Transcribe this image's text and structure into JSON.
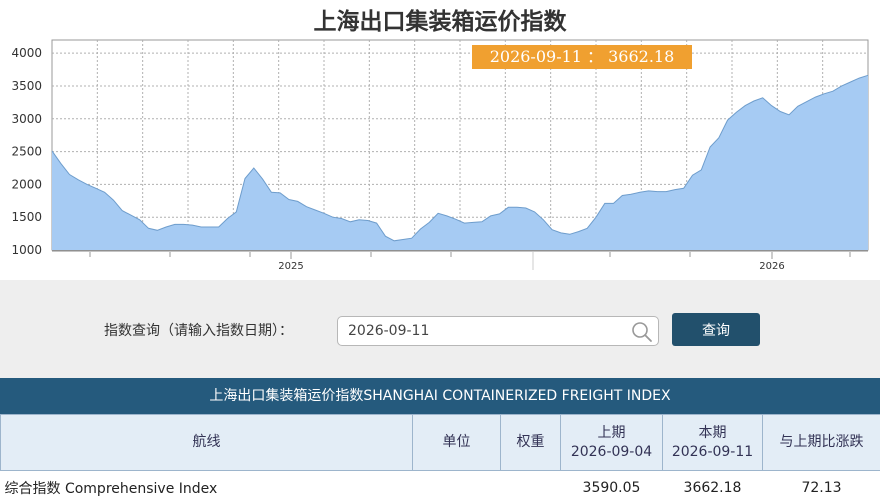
{
  "page": {
    "title": "上海出口集装箱运价指数"
  },
  "tooltip": {
    "text": "2026-09-11 ： 3662.18"
  },
  "colors": {
    "area_fill": "#a6cbf3",
    "area_line": "#6e9dcc",
    "tooltip_bg": "#f0a030",
    "header_bg": "#255a7d",
    "button_bg": "#22506c"
  },
  "chart_data": {
    "type": "area",
    "title": "上海出口集装箱运价指数",
    "xlabel": "",
    "ylabel": "",
    "ylim": [
      1000,
      4200
    ],
    "yticks": [
      1000,
      1500,
      2000,
      2500,
      3000,
      3500,
      4000
    ],
    "x_tick_labels": [
      "2025",
      "2026"
    ],
    "grid": true,
    "series": [
      {
        "values": [
          2510,
          2320,
          2150,
          2070,
          2000,
          1940,
          1880,
          1760,
          1600,
          1530,
          1460,
          1330,
          1300,
          1350,
          1390,
          1390,
          1380,
          1350,
          1350,
          1350,
          1480,
          1580,
          2090,
          2250,
          2080,
          1880,
          1870,
          1770,
          1740,
          1660,
          1610,
          1560,
          1500,
          1480,
          1430,
          1460,
          1450,
          1410,
          1210,
          1140,
          1160,
          1180,
          1320,
          1420,
          1560,
          1520,
          1470,
          1410,
          1420,
          1430,
          1520,
          1550,
          1650,
          1650,
          1640,
          1580,
          1460,
          1310,
          1260,
          1240,
          1280,
          1330,
          1500,
          1710,
          1710,
          1830,
          1850,
          1880,
          1900,
          1890,
          1890,
          1920,
          1940,
          2140,
          2220,
          2570,
          2710,
          2980,
          3100,
          3200,
          3270,
          3320,
          3200,
          3110,
          3060,
          3190,
          3260,
          3330,
          3380,
          3420,
          3500,
          3560,
          3620,
          3662.18
        ]
      }
    ]
  },
  "query": {
    "label": "指数查询（请输入指数日期）：",
    "value": "2026-09-11",
    "button": "查询"
  },
  "table": {
    "title": "上海出口集装箱运价指数SHANGHAI CONTAINERIZED FREIGHT INDEX",
    "headers": {
      "route": "航线",
      "unit": "单位",
      "weight": "权重",
      "prev": "上期",
      "prev_date": "2026-09-04",
      "current": "本期",
      "current_date": "2026-09-11",
      "change": "与上期比涨跌"
    },
    "rows": [
      {
        "route": "综合指数 Comprehensive Index",
        "unit": "",
        "weight": "",
        "prev": "3590.05",
        "current": "3662.18",
        "change": "72.13"
      }
    ]
  }
}
